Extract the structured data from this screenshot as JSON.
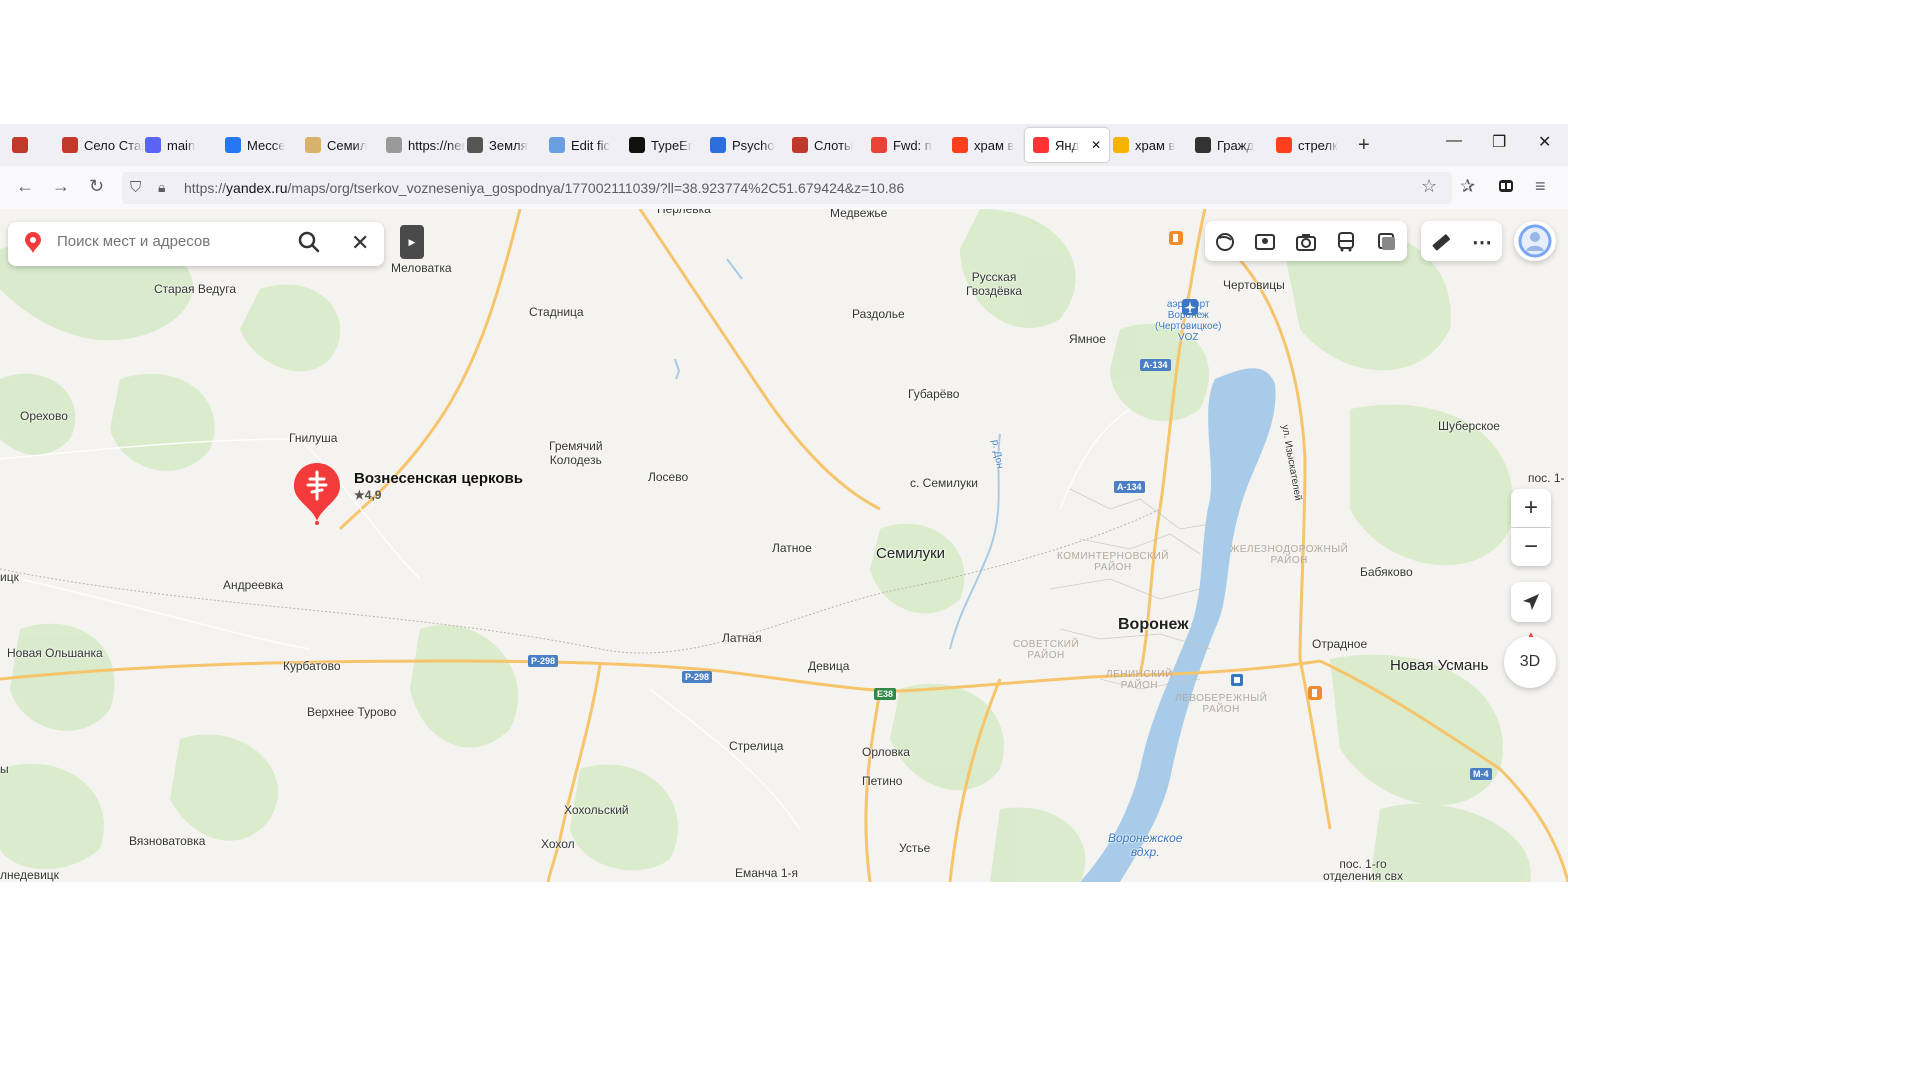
{
  "browser": {
    "tabs": [
      {
        "title": "Село Стар",
        "icon": "red-figure-icon",
        "color": "#c0392b"
      },
      {
        "title": "main",
        "icon": "discord-icon",
        "color": "#5865f2"
      },
      {
        "title": "Мессе",
        "icon": "messenger-icon",
        "color": "#2678f0"
      },
      {
        "title": "Семил",
        "icon": "site-icon",
        "color": "#d8b26a"
      },
      {
        "title": "https://ner",
        "icon": "blank-icon",
        "color": "#999999"
      },
      {
        "title": "Земля",
        "icon": "rocket-icon",
        "color": "#555555"
      },
      {
        "title": "Edit fic",
        "icon": "cloud-icon",
        "color": "#6aa0e0"
      },
      {
        "title": "TypeEr",
        "icon": "typeerror-icon",
        "color": "#111111"
      },
      {
        "title": "Psycho",
        "icon": "psycho-icon",
        "color": "#2a6fdb"
      },
      {
        "title": "Слоты",
        "icon": "red-figure-icon",
        "color": "#c0392b"
      },
      {
        "title": "Fwd: п",
        "icon": "gmail-icon",
        "color": "#ea4335"
      },
      {
        "title": "храм в",
        "icon": "yandex-icon",
        "color": "#fc3f1d"
      },
      {
        "title": "Янд",
        "icon": "yandex-maps-icon",
        "color": "#ff3333"
      },
      {
        "title": "храм в",
        "icon": "image-icon",
        "color": "#f5b400"
      },
      {
        "title": "Гражд",
        "icon": "brush-icon",
        "color": "#333333"
      },
      {
        "title": "стрелк",
        "icon": "yandex-icon",
        "color": "#fc3f1d"
      }
    ],
    "url_prefix": "https://",
    "url_domain": "yandex.ru",
    "url_rest": "/maps/org/tserkov_vozneseniya_gospodnya/177002111039/?ll=38.923774%2C51.679424&z=10.86"
  },
  "search": {
    "placeholder": "Поиск мест и адресов"
  },
  "pin": {
    "name": "Вознесенская церковь",
    "rating": "4,9",
    "color": "#f33b3b"
  },
  "controls": {
    "three_d": "3D",
    "zoom_in": "+",
    "zoom_out": "−"
  },
  "places": [
    {
      "name": "Перлевка",
      "cls": ""
    },
    {
      "name": "Медвежье",
      "cls": ""
    },
    {
      "name": "Меловатка",
      "cls": ""
    },
    {
      "name": "Старая Ведуга",
      "cls": ""
    },
    {
      "name": "Стадница",
      "cls": ""
    },
    {
      "name": "Русская\nГвоздёвка",
      "cls": ""
    },
    {
      "name": "Раздолье",
      "cls": ""
    },
    {
      "name": "Чертовицы",
      "cls": ""
    },
    {
      "name": "Ямное",
      "cls": ""
    },
    {
      "name": "Орехово",
      "cls": ""
    },
    {
      "name": "Губарёво",
      "cls": ""
    },
    {
      "name": "Гнилуша",
      "cls": ""
    },
    {
      "name": "Гремячий\nКолодезь",
      "cls": ""
    },
    {
      "name": "Лосево",
      "cls": ""
    },
    {
      "name": "с. Семилуки",
      "cls": ""
    },
    {
      "name": "Шуберское",
      "cls": ""
    },
    {
      "name": "Латное",
      "cls": ""
    },
    {
      "name": "Семилуки",
      "cls": "city"
    },
    {
      "name": "Андреевка",
      "cls": ""
    },
    {
      "name": "Бабяково",
      "cls": ""
    },
    {
      "name": "Воронеж",
      "cls": "big"
    },
    {
      "name": "Латная",
      "cls": ""
    },
    {
      "name": "Отрадное",
      "cls": ""
    },
    {
      "name": "Новая Ольшанка",
      "cls": ""
    },
    {
      "name": "Курбатово",
      "cls": ""
    },
    {
      "name": "Девица",
      "cls": ""
    },
    {
      "name": "Новая Усмань",
      "cls": "city"
    },
    {
      "name": "Верхнее Турово",
      "cls": ""
    },
    {
      "name": "Стрелица",
      "cls": ""
    },
    {
      "name": "Орловка",
      "cls": ""
    },
    {
      "name": "Петино",
      "cls": ""
    },
    {
      "name": "Хохольский",
      "cls": ""
    },
    {
      "name": "Вязноватовка",
      "cls": ""
    },
    {
      "name": "Хохол",
      "cls": ""
    },
    {
      "name": "Устье",
      "cls": ""
    },
    {
      "name": "Еманча 1-я",
      "cls": ""
    },
    {
      "name": "пос. 1-го\nотделения свх",
      "cls": ""
    },
    {
      "name": "ицк",
      "cls": ""
    },
    {
      "name": "ы",
      "cls": ""
    },
    {
      "name": "лнедевицк",
      "cls": ""
    },
    {
      "name": "пос. 1-",
      "cls": ""
    },
    {
      "name": "аэропорт\nВоронеж\n(Чертовицкое)\nVOZ",
      "cls": ""
    },
    {
      "name": "Воронежское\nвдхр.",
      "cls": ""
    }
  ],
  "districts": [
    "КОМИНТЕРНОВСКИЙ\nРАЙОН",
    "ЖЕЛЕЗНОДОРОЖНЫЙ\nРАЙОН",
    "СОВЕТСКИЙ\nРАЙОН",
    "ЛЕНИНСКИЙ\nРАЙОН",
    "ЛЕВОБЕРЕЖНЫЙ\nРАЙОН"
  ],
  "street": "ул. Изыскателей",
  "river": "р. Дон",
  "roads": [
    "А-134",
    "А-134",
    "Р-298",
    "Р-298",
    "E38",
    "М-4"
  ]
}
